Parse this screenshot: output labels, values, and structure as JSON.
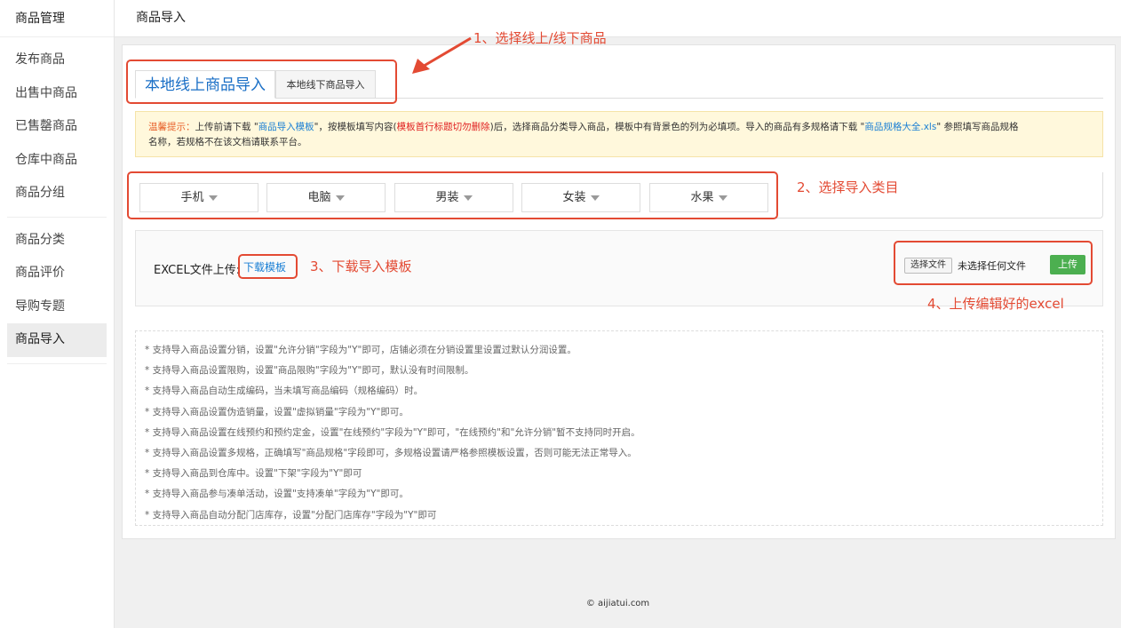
{
  "sidebar": {
    "title": "商品管理",
    "group1": [
      {
        "label": "发布商品"
      },
      {
        "label": "出售中商品"
      },
      {
        "label": "已售罄商品"
      },
      {
        "label": "仓库中商品"
      },
      {
        "label": "商品分组"
      }
    ],
    "group2": [
      {
        "label": "商品分类"
      },
      {
        "label": "商品评价"
      },
      {
        "label": "导购专题"
      },
      {
        "label": "商品导入",
        "active": true
      }
    ]
  },
  "header": {
    "title": "商品导入"
  },
  "tabs": [
    {
      "label": "本地线上商品导入",
      "active": true
    },
    {
      "label": "本地线下商品导入",
      "active": false
    }
  ],
  "notice": {
    "prefix": "温馨提示：",
    "t1": "上传前请下载 \"",
    "link1": "商品导入模板",
    "t2": "\"，按模板填写内容(",
    "red": "模板首行标题切勿删除",
    "t3": ")后，选择商品分类导入商品，模板中有背景色的列为必填项。导入的商品有多规格请下载 \"",
    "link2": "商品规格大全.xls",
    "t4": "\" 参照填写商品规格",
    "t5": "名称，若规格不在该文档请联系平台。"
  },
  "categories": [
    {
      "label": "手机"
    },
    {
      "label": "电脑"
    },
    {
      "label": "男装"
    },
    {
      "label": "女装"
    },
    {
      "label": "水果"
    }
  ],
  "upload": {
    "label": "EXCEL文件上传:",
    "download_link": "下载模板",
    "file_button": "选择文件",
    "file_status": "未选择任何文件",
    "upload_button": "上传"
  },
  "notes": [
    "* 支持导入商品设置分销，设置\"允许分销\"字段为\"Y\"即可，店铺必须在分销设置里设置过默认分润设置。",
    "* 支持导入商品设置限购，设置\"商品限购\"字段为\"Y\"即可，默认没有时间限制。",
    "* 支持导入商品自动生成编码，当未填写商品编码（规格编码）时。",
    "* 支持导入商品设置伪造销量，设置\"虚拟销量\"字段为\"Y\"即可。",
    "* 支持导入商品设置在线预约和预约定金，设置\"在线预约\"字段为\"Y\"即可，\"在线预约\"和\"允许分销\"暂不支持同时开启。",
    "* 支持导入商品设置多规格，正确填写\"商品规格\"字段即可，多规格设置请严格参照模板设置，否则可能无法正常导入。",
    "* 支持导入商品到仓库中。设置\"下架\"字段为\"Y\"即可",
    "* 支持导入商品参与凑单活动，设置\"支持凑单\"字段为\"Y\"即可。",
    "* 支持导入商品自动分配门店库存，设置\"分配门店库存\"字段为\"Y\"即可"
  ],
  "annotations": {
    "a1": "1、选择线上/线下商品",
    "a2": "2、选择导入类目",
    "a3": "3、下载导入模板",
    "a4": "4、上传编辑好的excel"
  },
  "footer": "© aijiatui.com",
  "colors": {
    "accent": "#1a7fd4",
    "annotation": "#e34a33",
    "upload_green": "#4caf50",
    "notice_bg": "#fff8dc"
  }
}
